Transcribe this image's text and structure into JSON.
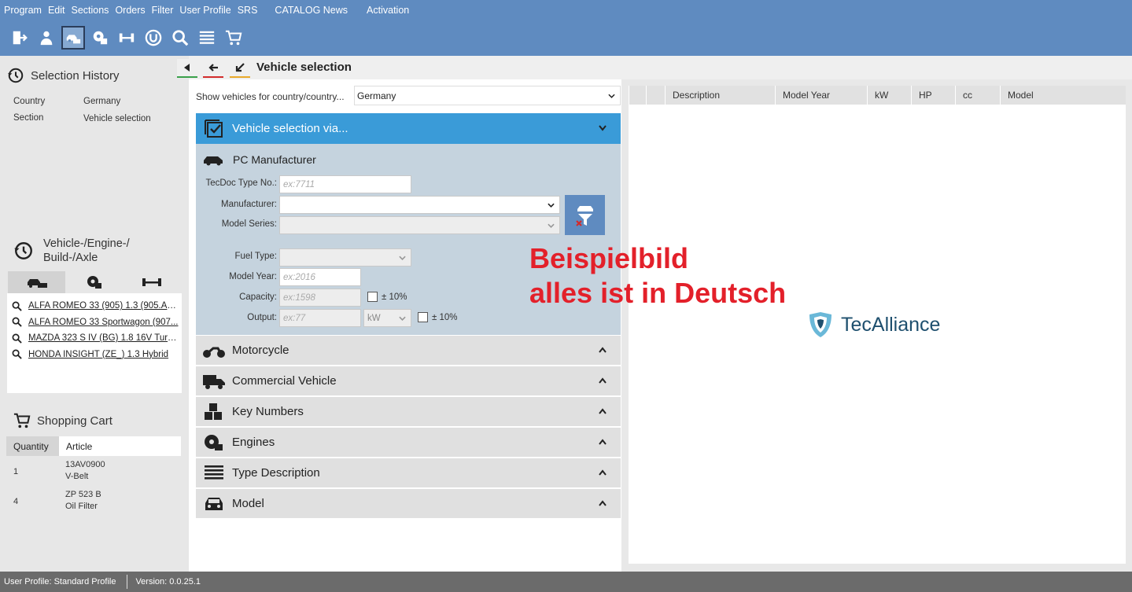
{
  "menu": [
    "Program",
    "Edit",
    "Sections",
    "Orders",
    "Filter",
    "User Profile",
    "SRS",
    "CATALOG News",
    "Activation"
  ],
  "toolbar_icons": [
    "exit-icon",
    "user-icon",
    "vehicle-selection-icon",
    "engine-icon",
    "axle-icon",
    "brand-icon",
    "search-icon",
    "list-icon",
    "cart-icon"
  ],
  "selection_history": {
    "title": "Selection History",
    "rows": [
      {
        "label": "Country",
        "value": "Germany"
      },
      {
        "label": "Section",
        "value": "Vehicle selection"
      }
    ]
  },
  "vehicle_history": {
    "title_line1": "Vehicle-/Engine-/",
    "title_line2": "Build-/Axle",
    "items": [
      "ALFA ROMEO 33 (905) 1.3 (905.A1...",
      "ALFA ROMEO 33 Sportwagon (907...",
      "MAZDA 323 S IV (BG) 1.8 16V Turb...",
      "HONDA INSIGHT (ZE_) 1.3 Hybrid"
    ]
  },
  "shopping_cart": {
    "title": "Shopping Cart",
    "col_quantity": "Quantity",
    "col_article": "Article",
    "rows": [
      {
        "qty": "1",
        "article": "13AV0900",
        "name": "V-Belt"
      },
      {
        "qty": "4",
        "article": "ZP 523 B",
        "name": "Oil Filter"
      }
    ]
  },
  "center": {
    "title": "Vehicle selection",
    "country_label": "Show vehicles for country/country...",
    "country_value": "Germany",
    "vs_header": "Vehicle selection via...",
    "pc": {
      "title": "PC Manufacturer",
      "type_no_label": "TecDoc Type No.:",
      "type_no_placeholder": "ex:7711",
      "manufacturer_label": "Manufacturer:",
      "model_series_label": "Model Series:",
      "fuel_label": "Fuel Type:",
      "year_label": "Model Year:",
      "year_placeholder": "ex:2016",
      "capacity_label": "Capacity:",
      "capacity_placeholder": "ex:1598",
      "output_label": "Output:",
      "output_placeholder": "ex:77",
      "output_unit": "kW",
      "tolerance": "± 10%"
    },
    "sections": [
      "Motorcycle",
      "Commercial Vehicle",
      "Key Numbers",
      "Engines",
      "Type Description",
      "Model"
    ]
  },
  "results_columns": [
    "Description",
    "Model Year",
    "kW",
    "HP",
    "cc",
    "Model"
  ],
  "overlay": {
    "line1": "Beispielbild",
    "line2": "alles ist in Deutsch"
  },
  "brand": "TecAlliance",
  "status": {
    "profile": "User Profile: Standard Profile",
    "version": "Version: 0.0.25.1"
  },
  "colors": {
    "accent": "#3a9bd8",
    "toolbar": "#5f8bc0",
    "overlay_red": "#e3202a",
    "panel": "#c5d3de"
  }
}
